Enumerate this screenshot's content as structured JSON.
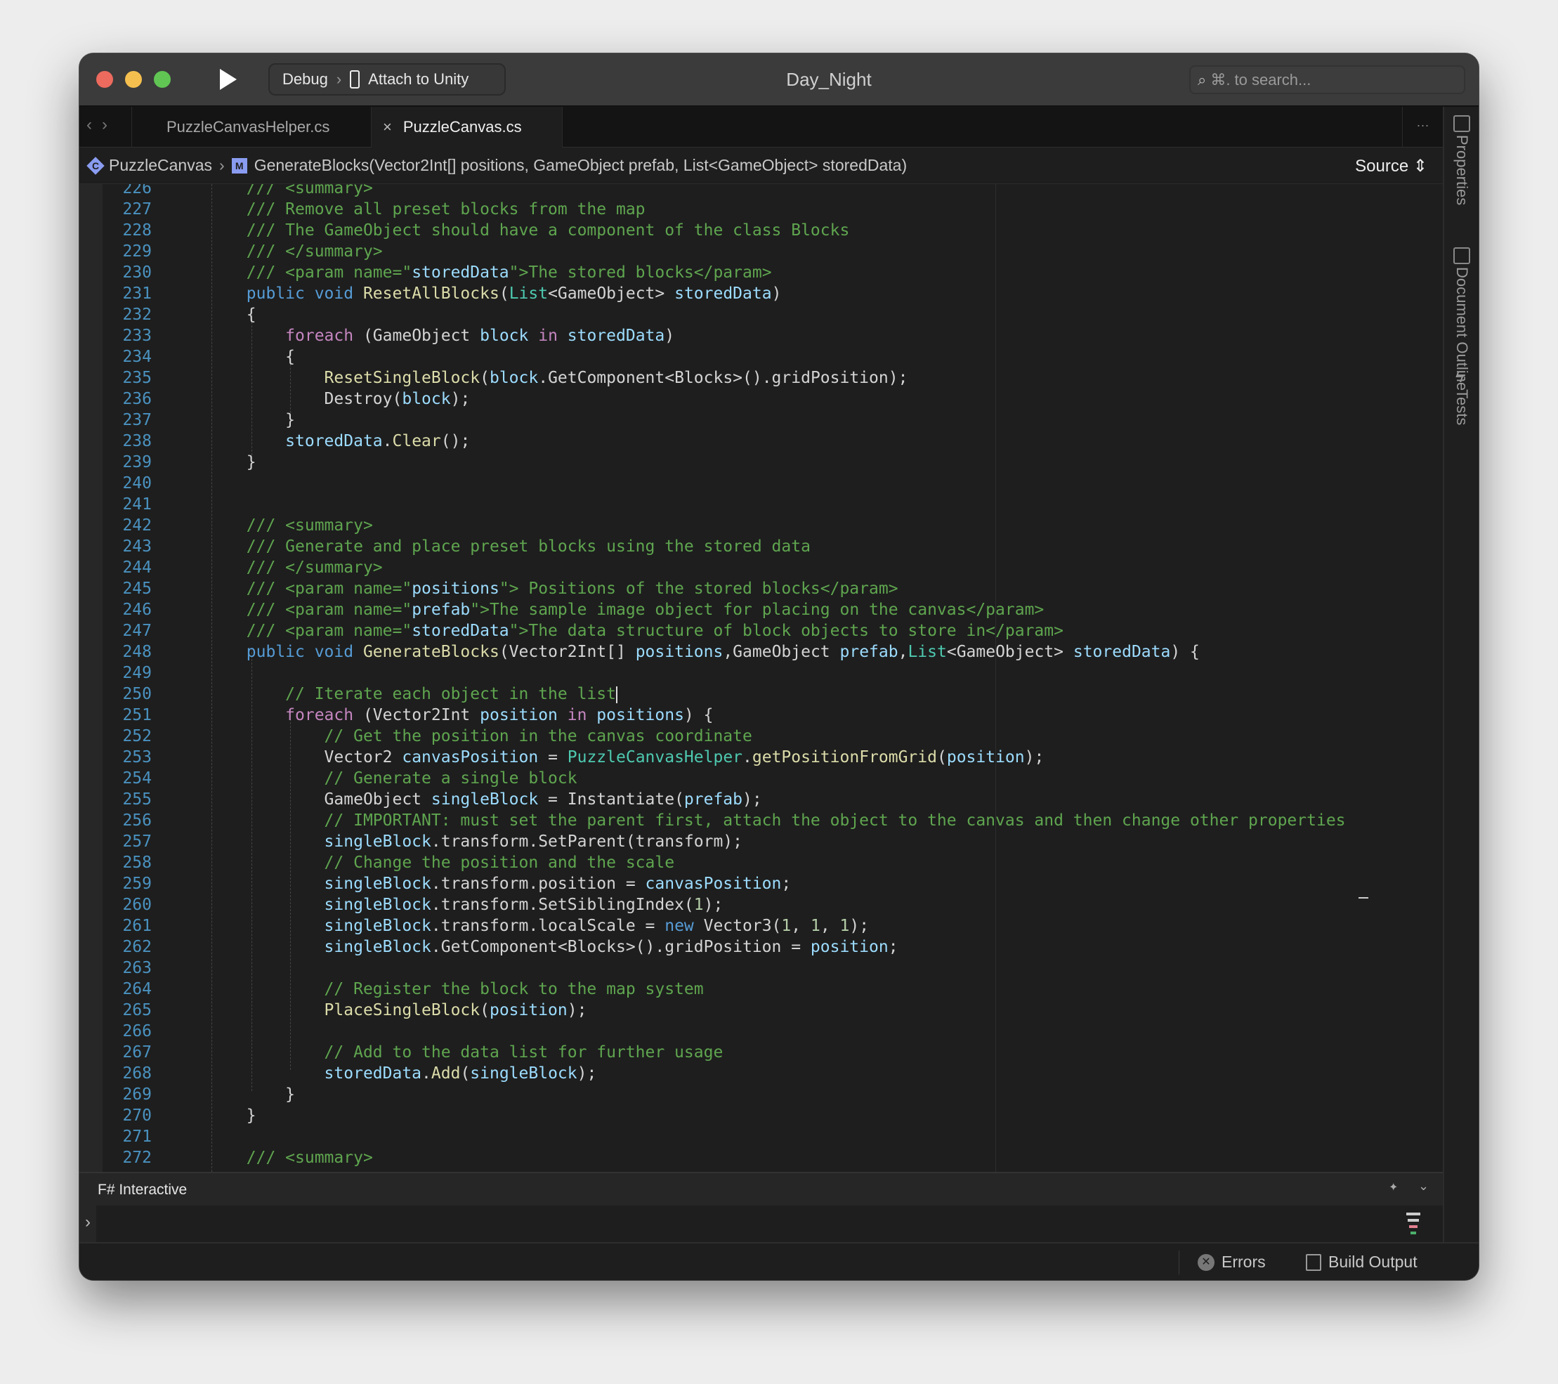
{
  "window": {
    "title": "Day_Night",
    "traffic_colors": [
      "#ed6a5e",
      "#f5bf4f",
      "#61c554"
    ]
  },
  "toolbar": {
    "config": "Debug",
    "target": "Attach to Unity",
    "search_placeholder": "⌘. to search..."
  },
  "tabs": [
    {
      "label": "PuzzleCanvasHelper.cs",
      "active": false
    },
    {
      "label": "PuzzleCanvas.cs",
      "active": true
    }
  ],
  "tab_close": "×",
  "more": "···",
  "breadcrumb": {
    "class_icon": "C",
    "class": "PuzzleCanvas",
    "method_icon": "M",
    "method": "GenerateBlocks(Vector2Int[] positions, GameObject prefab, List<GameObject> storedData)",
    "view": "Source"
  },
  "sidebar": [
    "Properties",
    "Document Outline",
    "Tests"
  ],
  "code": [
    {
      "n": "226",
      "s": [
        [
          "c",
          "        /// <summary>"
        ]
      ]
    },
    {
      "n": "227",
      "s": [
        [
          "c",
          "        /// Remove all preset blocks from the map"
        ]
      ]
    },
    {
      "n": "228",
      "s": [
        [
          "c",
          "        /// The GameObject should have a component of the class Blocks"
        ]
      ]
    },
    {
      "n": "229",
      "s": [
        [
          "c",
          "        /// </summary>"
        ]
      ]
    },
    {
      "n": "230",
      "s": [
        [
          "c",
          "        /// <param name=\""
        ],
        [
          "p",
          "storedData"
        ],
        [
          "c",
          "\">The stored blocks</param>"
        ]
      ]
    },
    {
      "n": "231",
      "s": [
        [
          "k",
          "        public void "
        ],
        [
          "m",
          "ResetAllBlocks"
        ],
        [
          "w",
          "("
        ],
        [
          "t",
          "List"
        ],
        [
          "w",
          "<GameObject> "
        ],
        [
          "p",
          "storedData"
        ],
        [
          "w",
          ")"
        ]
      ]
    },
    {
      "n": "232",
      "s": [
        [
          "w",
          "        {"
        ]
      ]
    },
    {
      "n": "233",
      "s": [
        [
          "f",
          "            foreach"
        ],
        [
          "w",
          " (GameObject "
        ],
        [
          "p",
          "block"
        ],
        [
          "f",
          " in "
        ],
        [
          "p",
          "storedData"
        ],
        [
          "w",
          ")"
        ]
      ]
    },
    {
      "n": "234",
      "s": [
        [
          "w",
          "            {"
        ]
      ]
    },
    {
      "n": "235",
      "s": [
        [
          "m",
          "                ResetSingleBlock"
        ],
        [
          "w",
          "("
        ],
        [
          "p",
          "block"
        ],
        [
          "w",
          ".GetComponent<Blocks>().gridPosition);"
        ]
      ]
    },
    {
      "n": "236",
      "s": [
        [
          "w",
          "                Destroy("
        ],
        [
          "p",
          "block"
        ],
        [
          "w",
          ");"
        ]
      ]
    },
    {
      "n": "237",
      "s": [
        [
          "w",
          "            }"
        ]
      ]
    },
    {
      "n": "238",
      "s": [
        [
          "p",
          "            storedData"
        ],
        [
          "w",
          "."
        ],
        [
          "m",
          "Clear"
        ],
        [
          "w",
          "();"
        ]
      ]
    },
    {
      "n": "239",
      "s": [
        [
          "w",
          "        }"
        ]
      ]
    },
    {
      "n": "240",
      "s": []
    },
    {
      "n": "241",
      "s": []
    },
    {
      "n": "242",
      "s": [
        [
          "c",
          "        /// <summary>"
        ]
      ]
    },
    {
      "n": "243",
      "s": [
        [
          "c",
          "        /// Generate and place preset blocks using the stored data"
        ]
      ]
    },
    {
      "n": "244",
      "s": [
        [
          "c",
          "        /// </summary>"
        ]
      ]
    },
    {
      "n": "245",
      "s": [
        [
          "c",
          "        /// <param name=\""
        ],
        [
          "p",
          "positions"
        ],
        [
          "c",
          "\"> Positions of the stored blocks</param>"
        ]
      ]
    },
    {
      "n": "246",
      "s": [
        [
          "c",
          "        /// <param name=\""
        ],
        [
          "p",
          "prefab"
        ],
        [
          "c",
          "\">The sample image object for placing on the canvas</param>"
        ]
      ]
    },
    {
      "n": "247",
      "s": [
        [
          "c",
          "        /// <param name=\""
        ],
        [
          "p",
          "storedData"
        ],
        [
          "c",
          "\">The data structure of block objects to store in</param>"
        ]
      ]
    },
    {
      "n": "248",
      "s": [
        [
          "k",
          "        public void "
        ],
        [
          "m",
          "GenerateBlocks"
        ],
        [
          "w",
          "(Vector2Int[] "
        ],
        [
          "p",
          "positions"
        ],
        [
          "w",
          ",GameObject "
        ],
        [
          "p",
          "prefab"
        ],
        [
          "w",
          ","
        ],
        [
          "t",
          "List"
        ],
        [
          "w",
          "<GameObject> "
        ],
        [
          "p",
          "storedData"
        ],
        [
          "w",
          ") {"
        ]
      ]
    },
    {
      "n": "249",
      "s": []
    },
    {
      "n": "250",
      "s": [
        [
          "c",
          "            // Iterate each object in the list"
        ]
      ],
      "caret": true
    },
    {
      "n": "251",
      "s": [
        [
          "f",
          "            foreach"
        ],
        [
          "w",
          " (Vector2Int "
        ],
        [
          "p",
          "position"
        ],
        [
          "f",
          " in "
        ],
        [
          "p",
          "positions"
        ],
        [
          "w",
          ") {"
        ]
      ]
    },
    {
      "n": "252",
      "s": [
        [
          "c",
          "                // Get the position in the canvas coordinate"
        ]
      ]
    },
    {
      "n": "253",
      "s": [
        [
          "w",
          "                Vector2 "
        ],
        [
          "p",
          "canvasPosition"
        ],
        [
          "w",
          " = "
        ],
        [
          "t",
          "PuzzleCanvasHelper"
        ],
        [
          "w",
          "."
        ],
        [
          "m",
          "getPositionFromGrid"
        ],
        [
          "w",
          "("
        ],
        [
          "p",
          "position"
        ],
        [
          "w",
          ");"
        ]
      ]
    },
    {
      "n": "254",
      "s": [
        [
          "c",
          "                // Generate a single block"
        ]
      ]
    },
    {
      "n": "255",
      "s": [
        [
          "w",
          "                GameObject "
        ],
        [
          "p",
          "singleBlock"
        ],
        [
          "w",
          " = Instantiate("
        ],
        [
          "p",
          "prefab"
        ],
        [
          "w",
          ");"
        ]
      ]
    },
    {
      "n": "256",
      "s": [
        [
          "c",
          "                // IMPORTANT: must set the parent first, attach the object to the canvas and then change other properties"
        ]
      ]
    },
    {
      "n": "257",
      "s": [
        [
          "p",
          "                singleBlock"
        ],
        [
          "w",
          ".transform.SetParent(transform);"
        ]
      ]
    },
    {
      "n": "258",
      "s": [
        [
          "c",
          "                // Change the position and the scale"
        ]
      ]
    },
    {
      "n": "259",
      "s": [
        [
          "p",
          "                singleBlock"
        ],
        [
          "w",
          ".transform.position = "
        ],
        [
          "p",
          "canvasPosition"
        ],
        [
          "w",
          ";"
        ]
      ]
    },
    {
      "n": "260",
      "s": [
        [
          "p",
          "                singleBlock"
        ],
        [
          "w",
          ".transform.SetSiblingIndex("
        ],
        [
          "n",
          "1"
        ],
        [
          "w",
          ");"
        ]
      ]
    },
    {
      "n": "261",
      "s": [
        [
          "p",
          "                singleBlock"
        ],
        [
          "w",
          ".transform.localScale = "
        ],
        [
          "k",
          "new"
        ],
        [
          "w",
          " Vector3("
        ],
        [
          "n",
          "1"
        ],
        [
          "w",
          ", "
        ],
        [
          "n",
          "1"
        ],
        [
          "w",
          ", "
        ],
        [
          "n",
          "1"
        ],
        [
          "w",
          ");"
        ]
      ]
    },
    {
      "n": "262",
      "s": [
        [
          "p",
          "                singleBlock"
        ],
        [
          "w",
          ".GetComponent<Blocks>().gridPosition = "
        ],
        [
          "p",
          "position"
        ],
        [
          "w",
          ";"
        ]
      ]
    },
    {
      "n": "263",
      "s": []
    },
    {
      "n": "264",
      "s": [
        [
          "c",
          "                // Register the block to the map system"
        ]
      ]
    },
    {
      "n": "265",
      "s": [
        [
          "m",
          "                PlaceSingleBlock"
        ],
        [
          "w",
          "("
        ],
        [
          "p",
          "position"
        ],
        [
          "w",
          ");"
        ]
      ]
    },
    {
      "n": "266",
      "s": []
    },
    {
      "n": "267",
      "s": [
        [
          "c",
          "                // Add to the data list for further usage"
        ]
      ]
    },
    {
      "n": "268",
      "s": [
        [
          "p",
          "                storedData"
        ],
        [
          "w",
          "."
        ],
        [
          "m",
          "Add"
        ],
        [
          "w",
          "("
        ],
        [
          "p",
          "singleBlock"
        ],
        [
          "w",
          ");"
        ]
      ]
    },
    {
      "n": "269",
      "s": [
        [
          "w",
          "            }"
        ]
      ]
    },
    {
      "n": "270",
      "s": [
        [
          "w",
          "        }"
        ]
      ]
    },
    {
      "n": "271",
      "s": []
    },
    {
      "n": "272",
      "s": [
        [
          "c",
          "        /// <summary>"
        ]
      ]
    }
  ],
  "panel": {
    "title": "F# Interactive",
    "prompt": "›",
    "pin": "📌",
    "collapse": "⌄"
  },
  "status": {
    "errors": "Errors",
    "build_output": "Build Output"
  }
}
